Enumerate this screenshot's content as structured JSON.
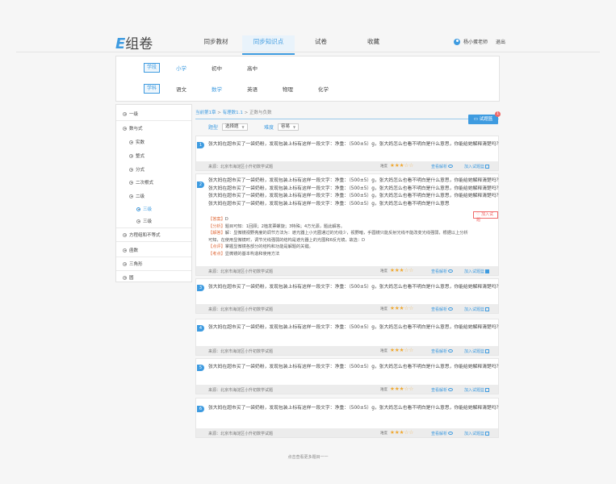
{
  "logo": {
    "e": "E",
    "rest": "组卷"
  },
  "nav": [
    {
      "label": "同步教材",
      "active": false
    },
    {
      "label": "同步知识点",
      "active": true
    },
    {
      "label": "试卷",
      "active": false
    },
    {
      "label": "收藏",
      "active": false
    }
  ],
  "user": {
    "name": "杨小蛋老师",
    "logout": "退出"
  },
  "filter": {
    "stage": {
      "label": "学段",
      "options": [
        "小学",
        "初中",
        "高中"
      ],
      "active": 0
    },
    "subject": {
      "label": "学科",
      "options": [
        "语文",
        "数学",
        "英语",
        "物理",
        "化学"
      ],
      "active": 1
    }
  },
  "sidebar": [
    {
      "label": "一级"
    },
    {
      "label": "数与式"
    },
    {
      "label": "实数"
    },
    {
      "label": "整式"
    },
    {
      "label": "分式"
    },
    {
      "label": "二次根式"
    },
    {
      "label": "二级"
    },
    {
      "label": "三级"
    },
    {
      "label": "三级"
    },
    {
      "label": "方程组和不等式"
    },
    {
      "label": "函数"
    },
    {
      "label": "三角形"
    },
    {
      "label": "圆"
    }
  ],
  "breadcrumb": {
    "current": "当前第1章",
    "sep1": " > ",
    "item": "有理数1.1",
    "sep2": " > ",
    "last": "正数与负数"
  },
  "basket": {
    "label": "试题篮",
    "count": "1"
  },
  "selectors": {
    "type": {
      "label": "题型",
      "value": "选择题"
    },
    "difficulty": {
      "label": "难度",
      "value": "容易"
    }
  },
  "question_text": "张大妈在超市买了一袋奶粉，发现包装上标有这样一段文字：净重：（500±5）g，张大妈怎么也看不明白是什么意思，你能给她解释清楚吗？",
  "question_text_short": "张大妈在超市买了一袋奶粉，发现包装上标有这样一段文字：净重：（500±5）g，张大妈怎么也看不明白是什么意思",
  "footer": {
    "source": "来源：北京市海淀区小升初数学试题",
    "difficulty_label": "难度",
    "analysis": "查看解析",
    "add": "加入试题篮"
  },
  "questions": [
    {
      "num": "1",
      "stars": 3
    },
    {
      "num": "2",
      "stars": 3
    },
    {
      "num": "3",
      "stars": 3
    },
    {
      "num": "4",
      "stars": 3
    },
    {
      "num": "5",
      "stars": 3
    },
    {
      "num": "6",
      "stars": 3
    }
  ],
  "answer": {
    "in_basket": "加入试题",
    "l1k": "【答案】",
    "l1": "D",
    "l2k": "【分析】",
    "l2": "题目可知：1回顾；2植发票螺旋；3特殊；4方光源，题此解答。",
    "l3k": "【解答】",
    "l3": "解：显微镜视野亮度的调节方法为：遮光器上小光圈通过的光线少，视野暗，手圆镜只能反射光线不能改变光线强弱，根据以上分析",
    "l4": "可知，在使用显微镜时，调节光线强弱的结构是遮光器上的光圈和6反光镜，故选：D",
    "l5k": "【点评】",
    "l5": "掌握显微镜各部分的结构和功能是解题的关键。",
    "l6k": "【考点】",
    "l6": "显微镜的基本构造和使用方法"
  },
  "load_more": "点击查看更多题目一一"
}
